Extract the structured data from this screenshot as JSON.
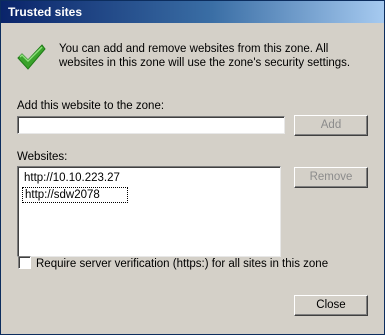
{
  "window": {
    "title": "Trusted sites"
  },
  "info": {
    "icon": "checkmark-icon",
    "text": "You can add and remove websites from this zone. All websites in this zone will use the zone's security settings."
  },
  "add_site": {
    "label": "Add this website to the zone:",
    "value": "",
    "add_button": "Add"
  },
  "websites": {
    "label": "Websites:",
    "items": [
      "http://10.10.223.27",
      "http://sdw2078"
    ],
    "remove_button": "Remove"
  },
  "verification": {
    "label": "Require server verification (https:) for all sites in this zone",
    "checked": false
  },
  "footer": {
    "close_button": "Close"
  },
  "colors": {
    "titlebar_start": "#0a246a",
    "titlebar_end": "#a6caf0",
    "dialog_background": "#d4d0c8",
    "check_green": "#3aa32b"
  }
}
